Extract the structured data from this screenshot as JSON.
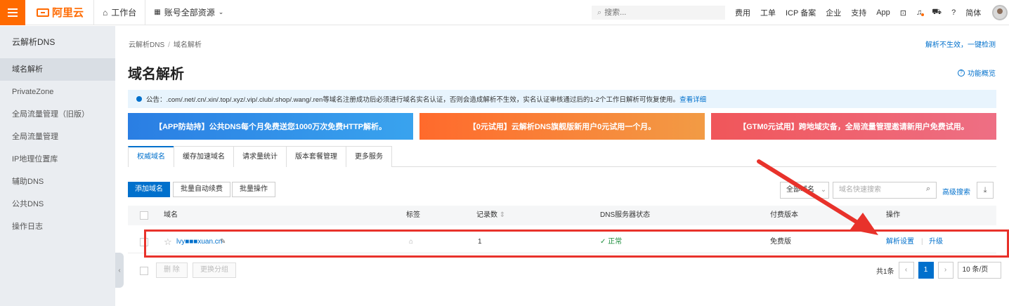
{
  "topbar": {
    "logo_text": "阿里云",
    "workbench": "工作台",
    "resources": "账号全部资源",
    "search_placeholder": "搜索...",
    "links": [
      "费用",
      "工单",
      "ICP 备案",
      "企业",
      "支持",
      "App"
    ],
    "lang": "简体"
  },
  "sidebar": {
    "title": "云解析DNS",
    "items": [
      "域名解析",
      "PrivateZone",
      "全局流量管理（旧版）",
      "全局流量管理",
      "IP地理位置库",
      "辅助DNS",
      "公共DNS",
      "操作日志"
    ]
  },
  "main": {
    "breadcrumb": [
      "云解析DNS",
      "域名解析"
    ],
    "top_right_link": "解析不生效，一键检测",
    "title": "域名解析",
    "overview": "功能概览",
    "notice_text": "公告：.com/.net/.cn/.xin/.top/.xyz/.vip/.club/.shop/.wang/.ren等域名注册成功后必须进行域名实名认证，否则会造成解析不生效，实名认证审核通过后的1-2个工作日解析可恢复使用。",
    "notice_link": "查看详细",
    "banners": [
      "【APP防劫持】公共DNS每个月免费送您1000万次免费HTTP解析。",
      "【0元试用】云解析DNS旗舰版新用户0元试用一个月。",
      "【GTM0元试用】跨地域灾备，全局流量管理邀请新用户免费试用。"
    ],
    "tabs": [
      "权威域名",
      "缓存加速域名",
      "请求量统计",
      "版本套餐管理",
      "更多服务"
    ],
    "buttons": {
      "add": "添加域名",
      "batch_renew": "批量自动续费",
      "batch_op": "批量操作",
      "delete": "删 除",
      "change_group": "更换分组"
    },
    "filter": "全部域名",
    "quick_search_placeholder": "域名快速搜索",
    "advanced_search": "高级搜索",
    "columns": [
      "域名",
      "标签",
      "记录数",
      "DNS服务器状态",
      "付费版本",
      "操作"
    ],
    "rows": [
      {
        "domain": "lvy■■■xuan.cn",
        "records": "1",
        "dns_status": "正常",
        "edition": "免费版",
        "action_settings": "解析设置",
        "action_upgrade": "升级"
      }
    ],
    "pager": {
      "total": "共1条",
      "current": "1",
      "page_size": "10 条/页"
    }
  },
  "colors": {
    "brand": "#ff6a00",
    "link": "#0070cc",
    "annotation": "#e8322b"
  }
}
